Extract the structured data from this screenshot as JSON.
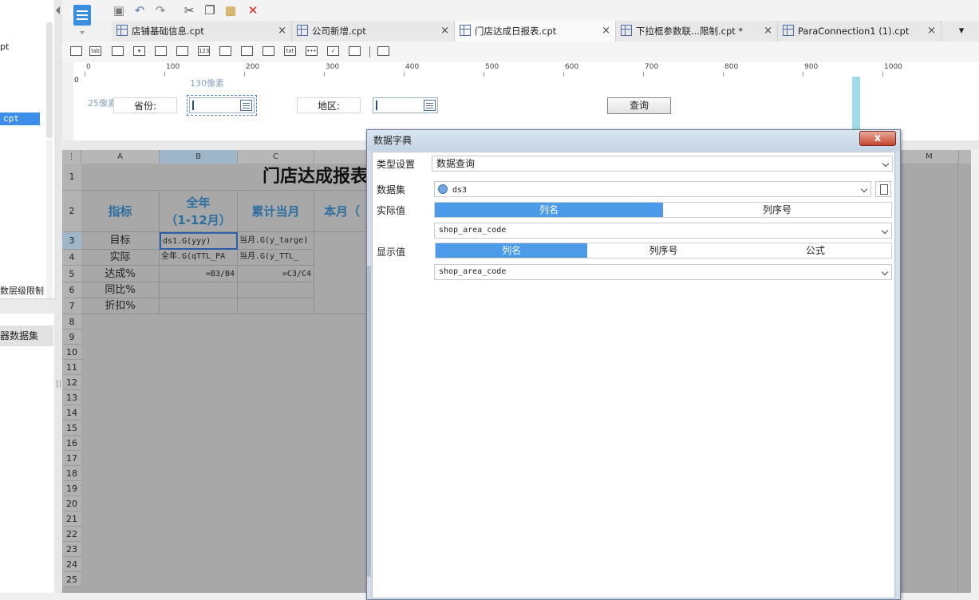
{
  "left_panel": {
    "item_top": "pt",
    "item_selected": "cpt",
    "item_bottom": "数层级限制",
    "tab_label": "器数据集"
  },
  "tabs": [
    {
      "label": "店铺基础信息.cpt",
      "close": "×"
    },
    {
      "label": "公司新增.cpt",
      "close": "×"
    },
    {
      "label": "门店达成日报表.cpt",
      "close": "×"
    },
    {
      "label": "下拉框参数联...限制.cpt *",
      "close": "×"
    },
    {
      "label": "ParaConnection1 (1).cpt",
      "close": "×"
    }
  ],
  "toolbar": {
    "icons": [
      "save-icon",
      "undo-icon",
      "redo-icon",
      "cut-icon",
      "copy-icon",
      "paste-icon",
      "delete-icon"
    ]
  },
  "ruler": {
    "labels": [
      "0",
      "100",
      "200",
      "300",
      "400",
      "500",
      "600",
      "700",
      "800",
      "900",
      "1000"
    ]
  },
  "param_pane": {
    "vruler_zero": "0",
    "width_hint": "130像素",
    "height_hint": "25像素",
    "province_label": "省份:",
    "region_label": "地区:",
    "query_button": "查询"
  },
  "grid": {
    "col_headers": [
      "A",
      "B",
      "C",
      "",
      "",
      "",
      "",
      "",
      "",
      "",
      "M"
    ],
    "row_numbers": [
      "1",
      "2",
      "3",
      "4",
      "5",
      "6",
      "7",
      "8",
      "9",
      "10",
      "11",
      "12",
      "13",
      "14",
      "15",
      "16",
      "17",
      "18",
      "19",
      "20",
      "21",
      "22",
      "23",
      "24",
      "25"
    ],
    "title": "门店达成报表",
    "header_a": "指标",
    "header_b_line1": "全年",
    "header_b_line2": "（1-12月）",
    "header_c": "累计当月",
    "header_d": "本月（",
    "row_labels": [
      "目标",
      "实际",
      "达成%",
      "同比%",
      "折扣%"
    ],
    "b3": "ds1.G(yyy)",
    "c3": "当月.G(y_targe)",
    "b4": "全年.G(qTTL_PA",
    "c4": "当月.G(y_TTL_",
    "b5": "=B3/B4",
    "c5": "=C3/C4"
  },
  "dialog": {
    "title": "数据字典",
    "close": "x",
    "type_label": "类型设置",
    "type_value": "数据查询",
    "dataset_label": "数据集",
    "dataset_value": "ds3",
    "actual_label": "实际值",
    "actual_seg": [
      "列名",
      "列序号"
    ],
    "actual_value": "shop_area_code",
    "display_label": "显示值",
    "display_seg": [
      "列名",
      "列序号",
      "公式"
    ],
    "display_value": "shop_area_code"
  }
}
